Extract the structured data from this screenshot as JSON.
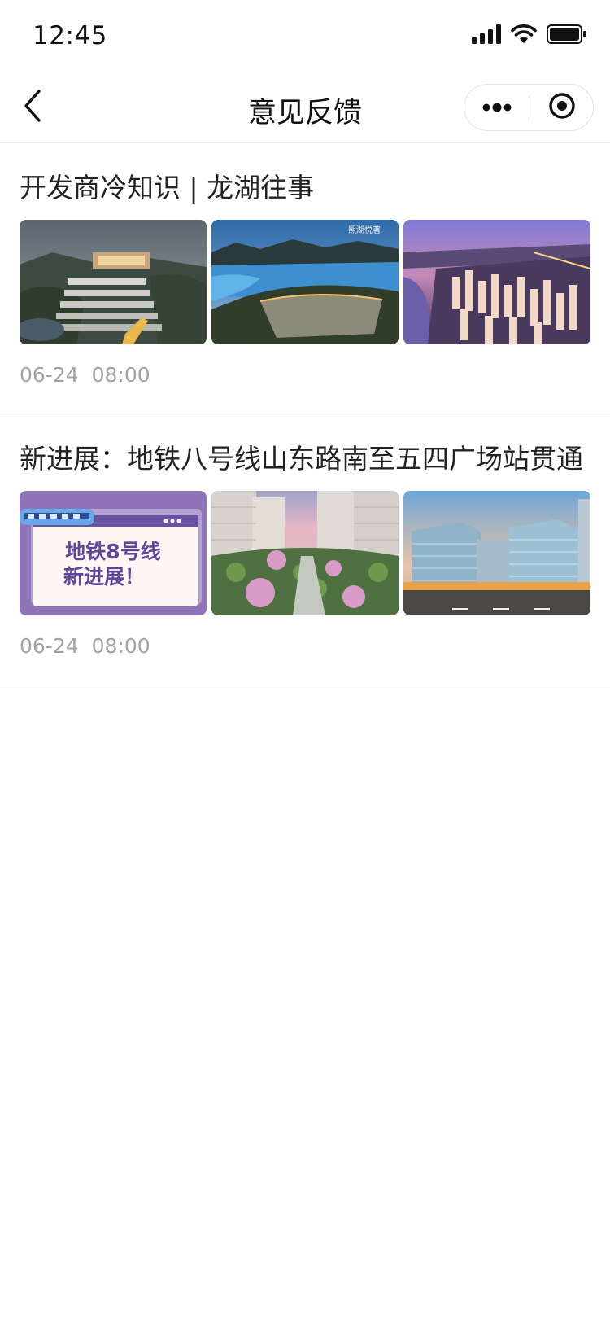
{
  "status_bar": {
    "time": "12:45",
    "icons": [
      "signal-icon",
      "wifi-icon",
      "battery-icon"
    ]
  },
  "nav": {
    "title": "意见反馈",
    "icons": [
      "chevron-left-icon",
      "more-icon",
      "target-icon"
    ]
  },
  "feed": [
    {
      "title": "开发商冷知识 | 龙湖往事",
      "date": "06-24",
      "time": "08:00",
      "images": [
        {
          "name": "terraced-villa-photo"
        },
        {
          "name": "lakeside-aerial-photo",
          "caption": "熙湖悦著"
        },
        {
          "name": "city-skyline-night-photo"
        }
      ]
    },
    {
      "title": "新进展：地铁八号线山东路南至五四广场站贯通",
      "date": "06-24",
      "time": "08:00",
      "images": [
        {
          "name": "metro-line-8-graphic",
          "line1": "地铁8号线",
          "line2": "新进展！"
        },
        {
          "name": "residential-garden-photo"
        },
        {
          "name": "commercial-complex-photo"
        }
      ]
    }
  ],
  "colors": {
    "accent_purple": "#8f75b8",
    "metro_text": "#5d479a",
    "meta_gray": "#a3a3a3",
    "divider": "#ececec"
  }
}
